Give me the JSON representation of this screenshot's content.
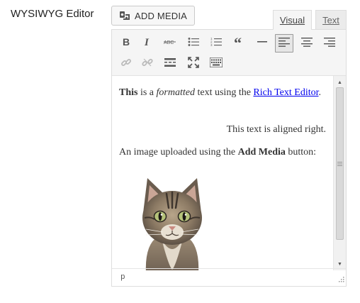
{
  "field": {
    "label": "WYSIWYG Editor"
  },
  "media_button": {
    "label": "ADD MEDIA",
    "icon": "add-media-icon"
  },
  "tabs": [
    {
      "label": "Visual",
      "active": true
    },
    {
      "label": "Text",
      "active": false
    }
  ],
  "toolbar": {
    "row1": [
      {
        "name": "bold",
        "icon": "bold-icon"
      },
      {
        "name": "italic",
        "icon": "italic-icon"
      },
      {
        "name": "strikethrough",
        "icon": "strikethrough-icon"
      },
      {
        "name": "bulleted-list",
        "icon": "bulleted-list-icon"
      },
      {
        "name": "numbered-list",
        "icon": "numbered-list-icon"
      },
      {
        "name": "blockquote",
        "icon": "quote-icon"
      },
      {
        "name": "horizontal-line",
        "icon": "horizontal-line-icon"
      },
      {
        "name": "align-left",
        "icon": "align-left-icon",
        "active": true
      },
      {
        "name": "align-center",
        "icon": "align-center-icon"
      },
      {
        "name": "align-right",
        "icon": "align-right-icon"
      }
    ],
    "row2": [
      {
        "name": "insert-link",
        "icon": "link-icon",
        "disabled": true
      },
      {
        "name": "remove-link",
        "icon": "unlink-icon",
        "disabled": true
      },
      {
        "name": "read-more",
        "icon": "read-more-icon"
      },
      {
        "name": "fullscreen",
        "icon": "fullscreen-icon"
      },
      {
        "name": "toolbar-toggle",
        "icon": "keyboard-icon"
      }
    ]
  },
  "content": {
    "p1": {
      "bold": "This",
      "t1": " is a ",
      "italic": "formatted",
      "t2": " text using the ",
      "link": "Rich Text Editor",
      "t3": "."
    },
    "p2": "This text is aligned right.",
    "p3": {
      "t1": "An image uploaded using the ",
      "bold": "Add Media",
      "t2": " button:"
    },
    "image": "cat-photo"
  },
  "scrollbar": {
    "position": 0.0
  },
  "statusbar": {
    "path": "p"
  }
}
